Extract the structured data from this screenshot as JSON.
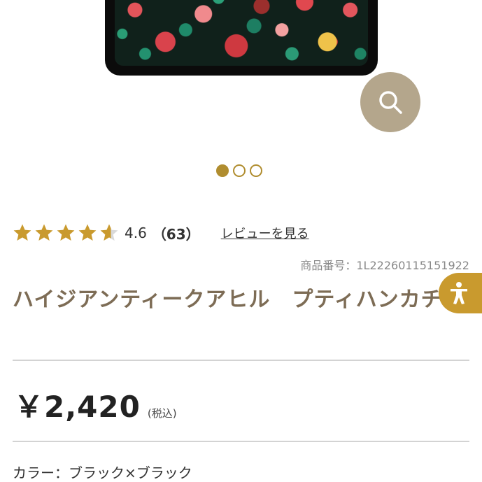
{
  "product": {
    "rating_value": "4.6",
    "review_count": "（63）",
    "review_link": "レビューを見る",
    "code": "商品番号：1L22260115151922",
    "title": "ハイジアンティークアヒル　プティハンカチ",
    "price": "￥2,420",
    "tax_note": "(税込)",
    "color": "カラー：ブラック×ブラック"
  },
  "rating": {
    "stars": 4.6,
    "max": 5
  },
  "carousel": {
    "total": 3,
    "active": 1
  },
  "icons": {
    "zoom": "search-icon",
    "accessibility": "accessibility-icon",
    "star": "star-icon"
  },
  "colors": {
    "accent": "#b08d2f",
    "star": "#c99a2e",
    "title": "#7d6c55",
    "zoom_button": "#b4a68c",
    "accessibility_button": "#c99a2e"
  }
}
